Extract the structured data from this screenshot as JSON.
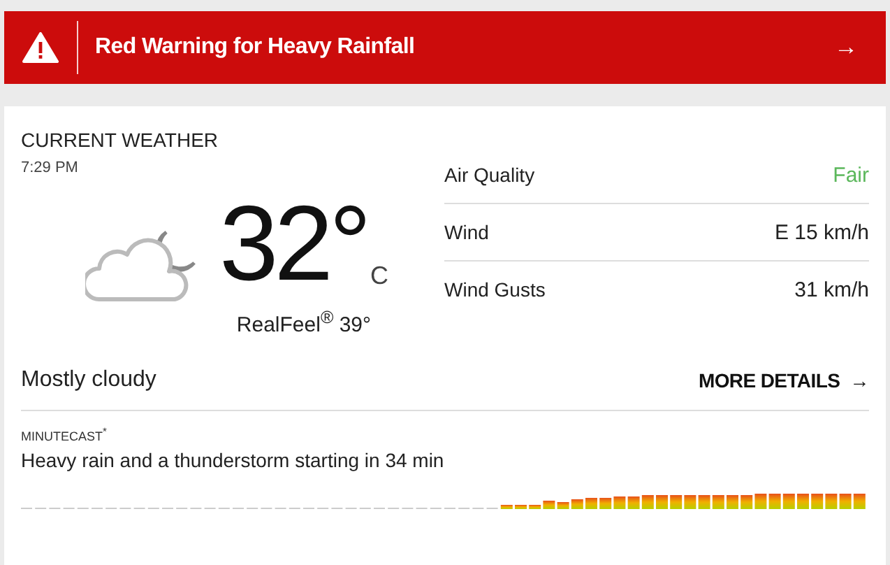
{
  "alert": {
    "title": "Red Warning for Heavy Rainfall",
    "arrow": "→"
  },
  "current": {
    "heading": "CURRENT WEATHER",
    "time": "7:29 PM",
    "temperature": "32°",
    "unit": "C",
    "realfeel": "RealFeel$^{®}$ 39°",
    "condition": "Mostly cloudy",
    "details": [
      {
        "label": "Air Quality",
        "value": "Fair",
        "color": "#5cb85c"
      },
      {
        "label": "Wind",
        "value": "E 15 km/h"
      },
      {
        "label": "Wind Gusts",
        "value": "31 km/h"
      }
    ],
    "more": {
      "label": "MORE DETAILS",
      "arrow": "→"
    }
  },
  "minutecast": {
    "label": "MINUTECAST$^{*}$",
    "summary": "Heavy rain and a thunderstorm starting in 34 min"
  }
}
